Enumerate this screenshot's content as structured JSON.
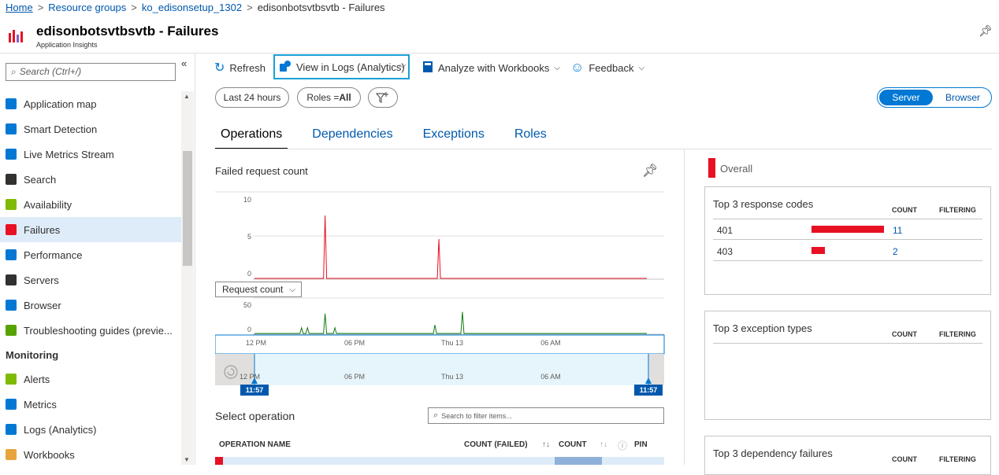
{
  "breadcrumb": {
    "home": "Home",
    "resource_groups": "Resource groups",
    "group": "ko_edisonsetup_1302",
    "current": "edisonbotsvtbsvtb - Failures"
  },
  "header": {
    "title": "edisonbotsvtbsvtb - Failures",
    "subtitle": "Application Insights"
  },
  "sidebar": {
    "search_placeholder": "Search (Ctrl+/)",
    "items": [
      {
        "label": "Application map",
        "icon": "app-map-icon",
        "color": "#0078d4"
      },
      {
        "label": "Smart Detection",
        "icon": "smart-detection-icon",
        "color": "#0078d4"
      },
      {
        "label": "Live Metrics Stream",
        "icon": "live-metrics-icon",
        "color": "#0078d4"
      },
      {
        "label": "Search",
        "icon": "search-icon",
        "color": "#323130"
      },
      {
        "label": "Availability",
        "icon": "globe-icon",
        "color": "#7fba00"
      },
      {
        "label": "Failures",
        "icon": "failures-icon",
        "color": "#e81123"
      },
      {
        "label": "Performance",
        "icon": "performance-icon",
        "color": "#0078d4"
      },
      {
        "label": "Servers",
        "icon": "server-icon",
        "color": "#323130"
      },
      {
        "label": "Browser",
        "icon": "browser-icon",
        "color": "#0078d4"
      },
      {
        "label": "Troubleshooting guides (previe...",
        "icon": "troubleshoot-icon",
        "color": "#57a300"
      }
    ],
    "monitoring_heading": "Monitoring",
    "monitoring_items": [
      {
        "label": "Alerts",
        "icon": "alert-icon",
        "color": "#7fba00"
      },
      {
        "label": "Metrics",
        "icon": "metrics-icon",
        "color": "#0078d4"
      },
      {
        "label": "Logs (Analytics)",
        "icon": "logs-icon",
        "color": "#0078d4"
      },
      {
        "label": "Workbooks",
        "icon": "workbooks-icon",
        "color": "#e8a33d"
      }
    ]
  },
  "toolbar": {
    "refresh": "Refresh",
    "view_logs": "View in Logs (Analytics)",
    "workbooks": "Analyze with Workbooks",
    "feedback": "Feedback"
  },
  "filters": {
    "time_range": "Last 24 hours",
    "roles_label": "Roles = ",
    "roles_value": "All"
  },
  "toggle": {
    "server": "Server",
    "browser": "Browser"
  },
  "tabs": [
    "Operations",
    "Dependencies",
    "Exceptions",
    "Roles"
  ],
  "chart": {
    "title": "Failed request count",
    "request_dropdown": "Request count",
    "failed_ticks": [
      "10",
      "5",
      "0"
    ],
    "request_ticks": [
      "50",
      "0"
    ],
    "x_ticks": [
      "12 PM",
      "06 PM",
      "Thu 13",
      "06 AM"
    ],
    "range_start": "11:57",
    "range_end": "11:57"
  },
  "chart_data": [
    {
      "type": "line",
      "title": "Failed request count",
      "ylim": [
        0,
        10
      ],
      "x": [
        "12 PM",
        "06 PM",
        "Thu 13",
        "06 AM"
      ],
      "series": [
        {
          "name": "",
          "peaks": [
            {
              "at_fraction": 0.18,
              "value": 8
            },
            {
              "at_fraction": 0.47,
              "value": 5
            }
          ]
        }
      ]
    },
    {
      "type": "line",
      "title": "Request count",
      "ylim": [
        0,
        50
      ],
      "series": [
        {
          "name": "",
          "peaks": [
            {
              "at_fraction": 0.12,
              "value": 10
            },
            {
              "at_fraction": 0.135,
              "value": 10
            },
            {
              "at_fraction": 0.18,
              "value": 35
            },
            {
              "at_fraction": 0.205,
              "value": 10
            },
            {
              "at_fraction": 0.46,
              "value": 15
            },
            {
              "at_fraction": 0.53,
              "value": 38
            }
          ]
        }
      ]
    }
  ],
  "operations": {
    "select_label": "Select operation",
    "filter_placeholder": "Search to filter items...",
    "columns": [
      "OPERATION NAME",
      "COUNT (FAILED)",
      "COUNT",
      "PIN"
    ]
  },
  "right": {
    "overall": "Overall",
    "response_codes": {
      "title": "Top 3 response codes",
      "count_header": "COUNT",
      "filtering_header": "FILTERING",
      "rows": [
        {
          "code": "401",
          "count": "11",
          "fraction": 1.0
        },
        {
          "code": "403",
          "count": "2",
          "fraction": 0.18
        }
      ]
    },
    "exception_types": {
      "title": "Top 3 exception types",
      "count_header": "COUNT",
      "filtering_header": "FILTERING"
    },
    "dependency_failures": {
      "title": "Top 3 dependency failures",
      "count_header": "COUNT",
      "filtering_header": "FILTERING"
    }
  },
  "colors": {
    "accent": "#0078d4",
    "failure": "#e81123",
    "success": "#107c10",
    "highlight_border": "#1aa0d6"
  }
}
